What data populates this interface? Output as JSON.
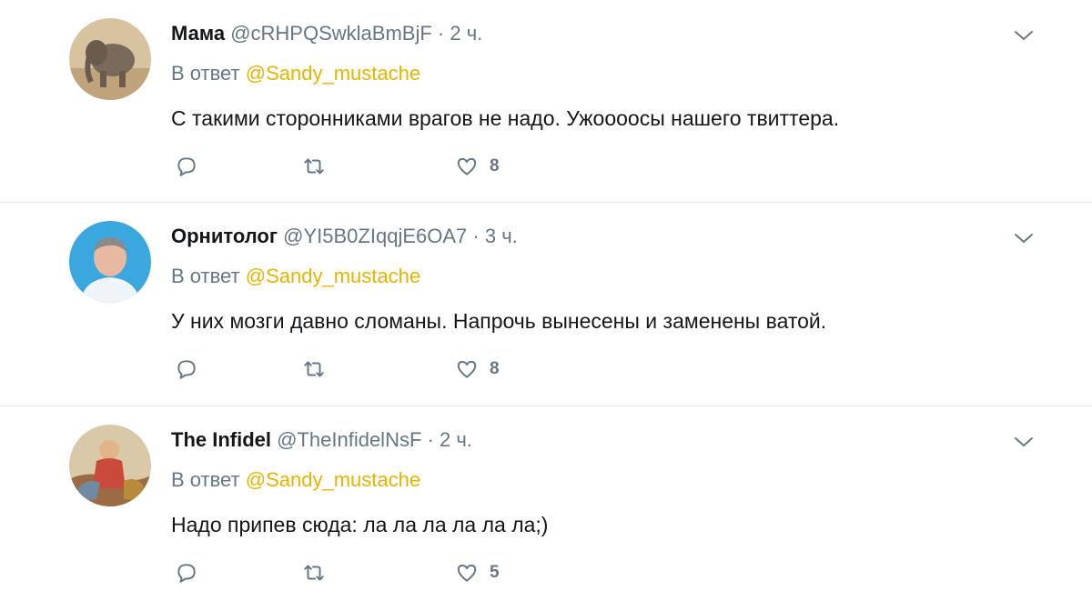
{
  "tweets": [
    {
      "name": "Мама",
      "handle": "@cRHPQSwklaBmBjF",
      "separator": "·",
      "time": "2 ч.",
      "reply_prefix": "В ответ",
      "reply_mention": "@Sandy_mustache",
      "text": "С такими сторонниками врагов не надо. Ужоооосы нашего твиттера.",
      "likes": "8",
      "avatar": "elephant-avatar"
    },
    {
      "name": "Орнитолог",
      "handle": "@YI5B0ZIqqjE6OA7",
      "separator": "·",
      "time": "3 ч.",
      "reply_prefix": "В ответ",
      "reply_mention": "@Sandy_mustache",
      "text": "У них мозги давно сломаны. Напрочь вынесены и заменены ватой.",
      "likes": "8",
      "avatar": "man-portrait-avatar"
    },
    {
      "name": "The Infidel",
      "handle": "@TheInfidelNsF",
      "separator": "·",
      "time": "2 ч.",
      "reply_prefix": "В ответ",
      "reply_mention": "@Sandy_mustache",
      "text": "Надо припев сюда: ла ла ла ла ла ла;)",
      "likes": "5",
      "avatar": "painting-avatar"
    }
  ],
  "colors": {
    "mention": "#e8b400",
    "muted": "#657786",
    "text": "#14171a",
    "divider": "#e1e8ed"
  }
}
